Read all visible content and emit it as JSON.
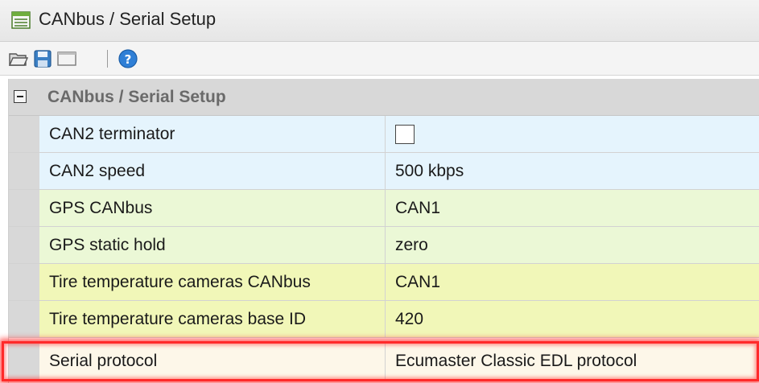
{
  "window": {
    "title": "CANbus / Serial Setup",
    "icon": "table-window-icon"
  },
  "toolbar": {
    "buttons": [
      {
        "icon": "open-folder-icon"
      },
      {
        "icon": "save-icon"
      },
      {
        "icon": "window-icon"
      },
      {
        "icon": "help-icon"
      }
    ]
  },
  "grid": {
    "group_title": "CANbus / Serial Setup",
    "rows": [
      {
        "name": "CAN2 terminator",
        "value": "",
        "type": "checkbox",
        "checked": false,
        "color": "#e5f4fd"
      },
      {
        "name": "CAN2 speed",
        "value": "500 kbps",
        "color": "#e5f4fd"
      },
      {
        "name": "GPS CANbus",
        "value": "CAN1",
        "color": "#ebf8d6"
      },
      {
        "name": "GPS static hold",
        "value": "zero",
        "color": "#ebf8d6"
      },
      {
        "name": "Tire temperature cameras CANbus",
        "value": "CAN1",
        "color": "#f1f7b8"
      },
      {
        "name": "Tire temperature cameras base ID",
        "value": "420",
        "color": "#f1f7b8"
      },
      {
        "name": "Serial protocol",
        "value": "Ecumaster Classic EDL protocol",
        "color": "#fdf7e9",
        "highlighted": true
      }
    ]
  },
  "colors": {
    "highlight": "#ff2a2a",
    "gutter": "#d8d8d8"
  }
}
